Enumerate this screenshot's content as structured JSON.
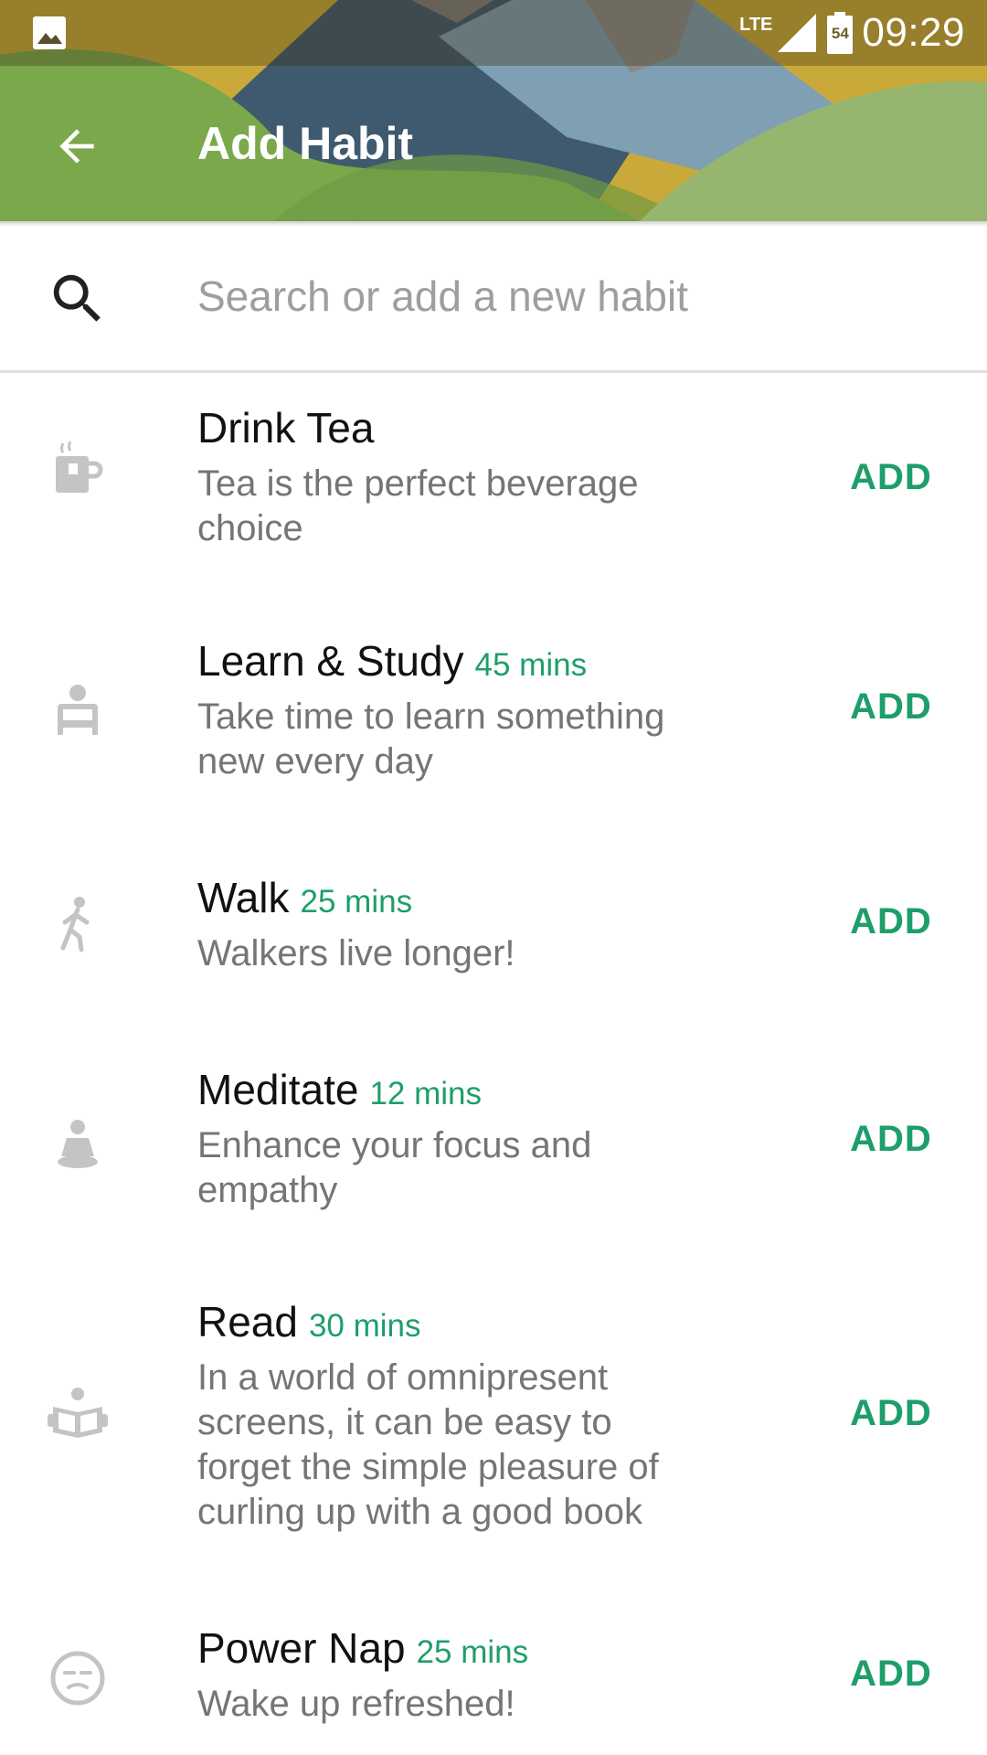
{
  "status_bar": {
    "network": "LTE",
    "battery": "54",
    "time": "09:29"
  },
  "app_bar": {
    "title": "Add Habit",
    "back_icon": "arrow-back-icon"
  },
  "search": {
    "placeholder": "Search or add a new habit",
    "icon": "search-icon"
  },
  "colors": {
    "accent": "#1e9e6a",
    "icon_gray": "#bdbdbd",
    "desc_gray": "#757575"
  },
  "habits": [
    {
      "title": "Drink Tea",
      "duration": "",
      "description": "Tea is the perfect beverage choice",
      "icon": "tea-cup-icon",
      "action": "ADD"
    },
    {
      "title": "Learn & Study",
      "duration": "45 mins",
      "description": "Take time to learn something new every day",
      "icon": "study-desk-icon",
      "action": "ADD"
    },
    {
      "title": "Walk",
      "duration": "25 mins",
      "description": "Walkers live longer!",
      "icon": "walking-person-icon",
      "action": "ADD"
    },
    {
      "title": "Meditate",
      "duration": "12 mins",
      "description": "Enhance your focus and empathy",
      "icon": "meditation-icon",
      "action": "ADD"
    },
    {
      "title": "Read",
      "duration": "30 mins",
      "description": "In a world of omnipresent screens, it can be easy to forget the simple pleasure of curling up with a good book",
      "icon": "open-book-icon",
      "action": "ADD"
    },
    {
      "title": "Power Nap",
      "duration": "25 mins",
      "description": "Wake up refreshed!",
      "icon": "sleeping-face-icon",
      "action": "ADD"
    }
  ]
}
